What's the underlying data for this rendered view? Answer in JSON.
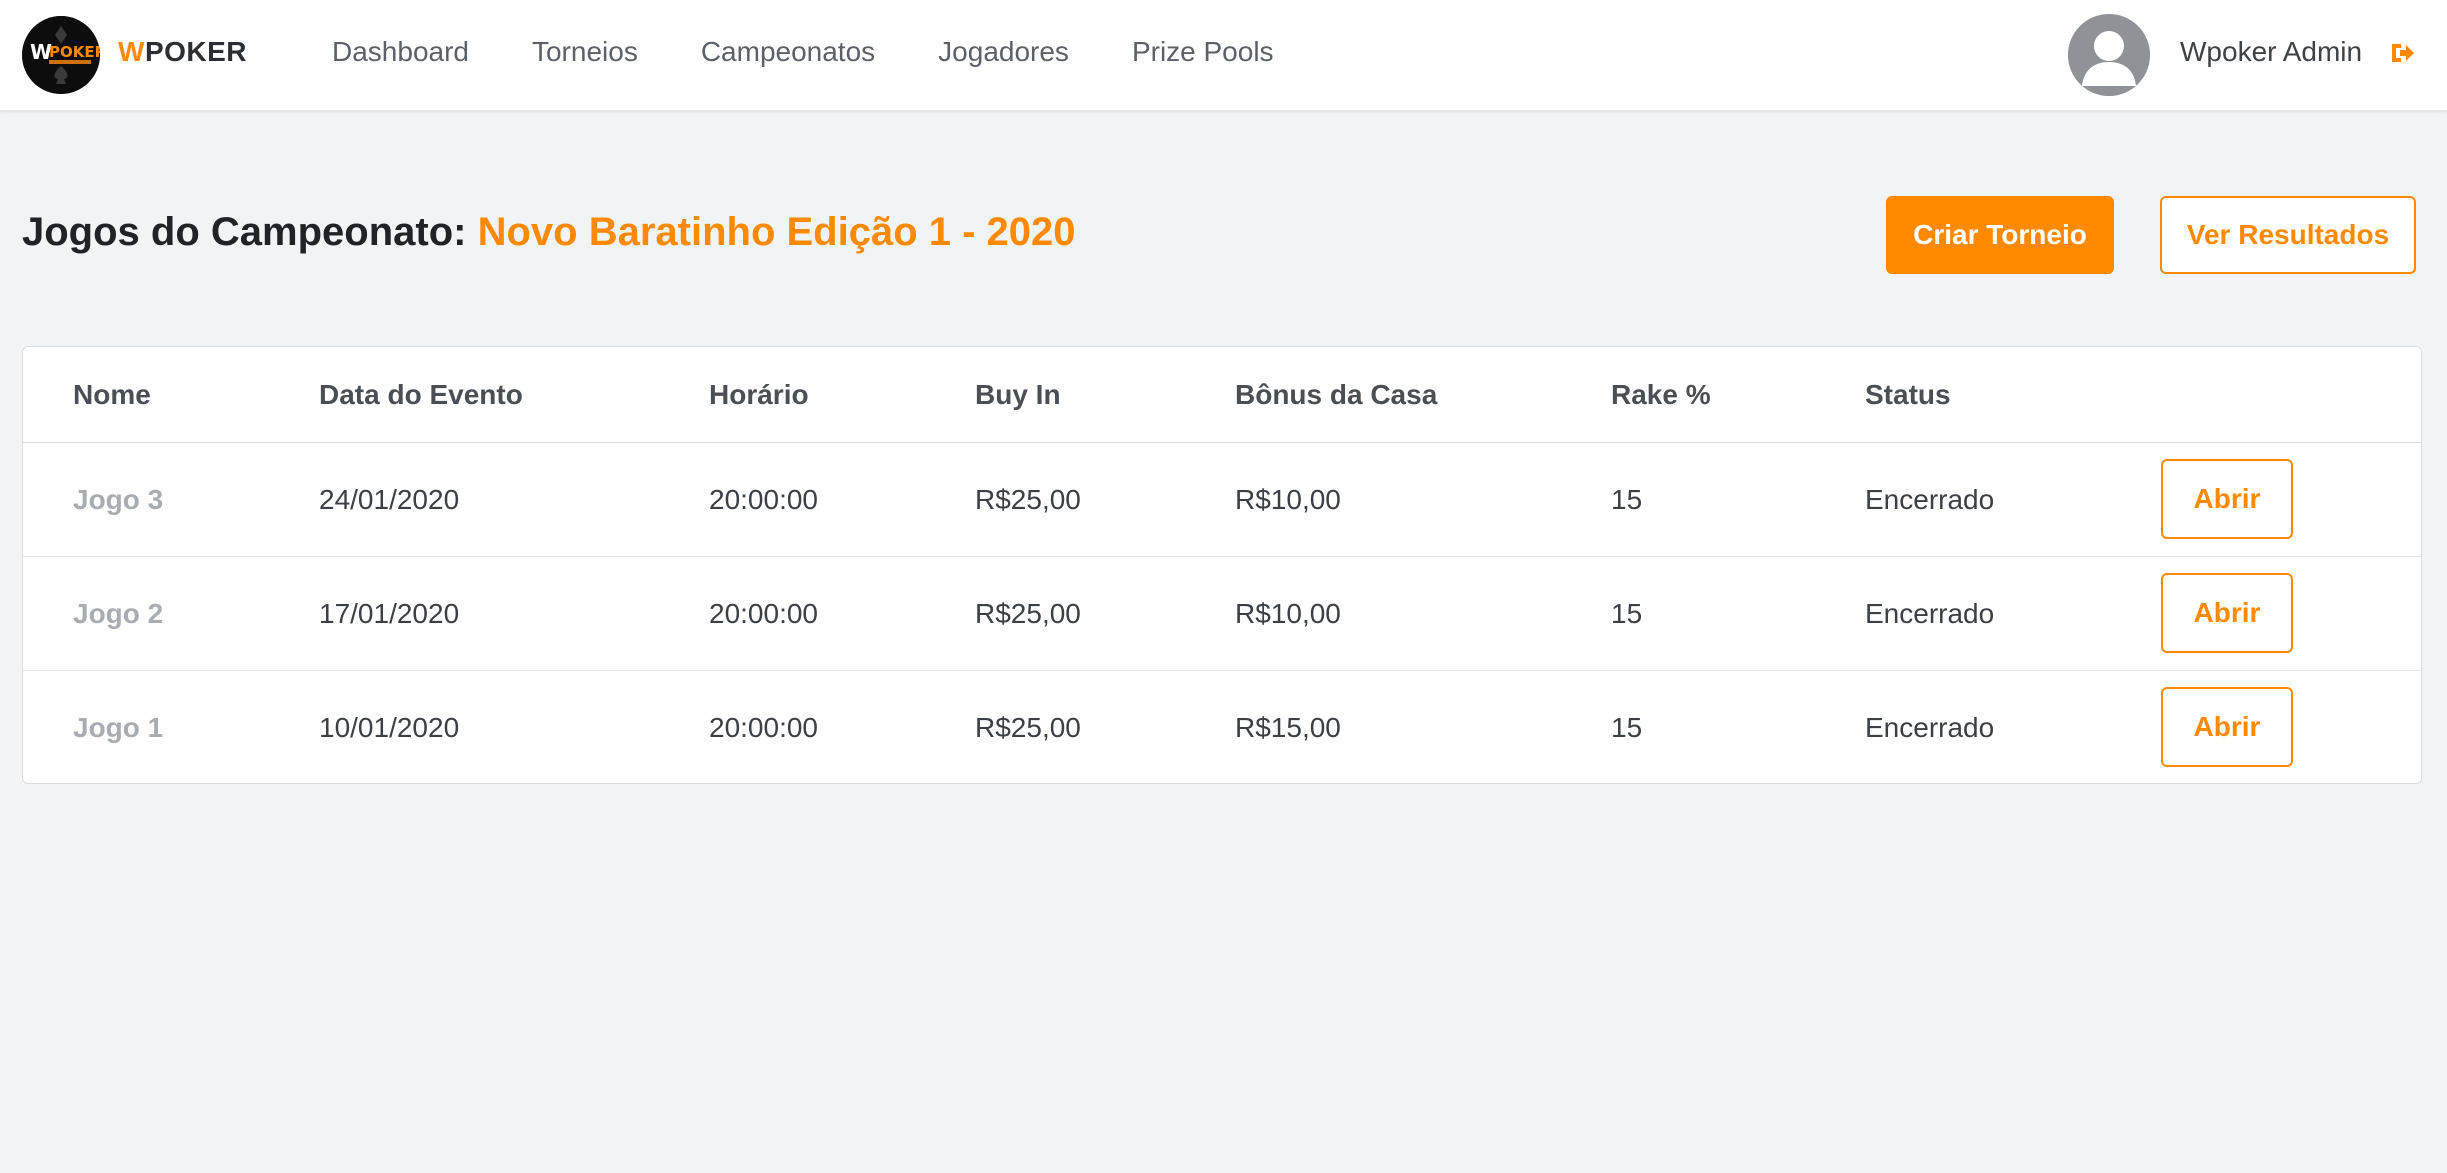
{
  "brand": {
    "w": "W",
    "rest": "POKER",
    "logo_text": "WPOKER"
  },
  "nav": [
    "Dashboard",
    "Torneios",
    "Campeonatos",
    "Jogadores",
    "Prize Pools"
  ],
  "user": {
    "name": "Wpoker Admin"
  },
  "page": {
    "title_prefix": "Jogos do Campeonato:",
    "championship": "Novo Baratinho Edição 1 - 2020",
    "create_button": "Criar Torneio",
    "results_button": "Ver Resultados"
  },
  "table": {
    "headers": [
      "Nome",
      "Data do Evento",
      "Horário",
      "Buy In",
      "Bônus da Casa",
      "Rake %",
      "Status"
    ],
    "rows": [
      {
        "name": "Jogo 3",
        "date": "24/01/2020",
        "time": "20:00:00",
        "buy_in": "R$25,00",
        "bonus": "R$10,00",
        "rake": "15",
        "status": "Encerrado",
        "action": "Abrir"
      },
      {
        "name": "Jogo 2",
        "date": "17/01/2020",
        "time": "20:00:00",
        "buy_in": "R$25,00",
        "bonus": "R$10,00",
        "rake": "15",
        "status": "Encerrado",
        "action": "Abrir"
      },
      {
        "name": "Jogo 1",
        "date": "10/01/2020",
        "time": "20:00:00",
        "buy_in": "R$25,00",
        "bonus": "R$15,00",
        "rake": "15",
        "status": "Encerrado",
        "action": "Abrir"
      }
    ]
  },
  "icons": {
    "logo": "wpoker-logo",
    "avatar": "user-avatar-icon",
    "logout": "logout-icon"
  },
  "colors": {
    "accent": "#ff8a00",
    "background": "#f1f4f7",
    "muted_name": "#a7adb3"
  }
}
